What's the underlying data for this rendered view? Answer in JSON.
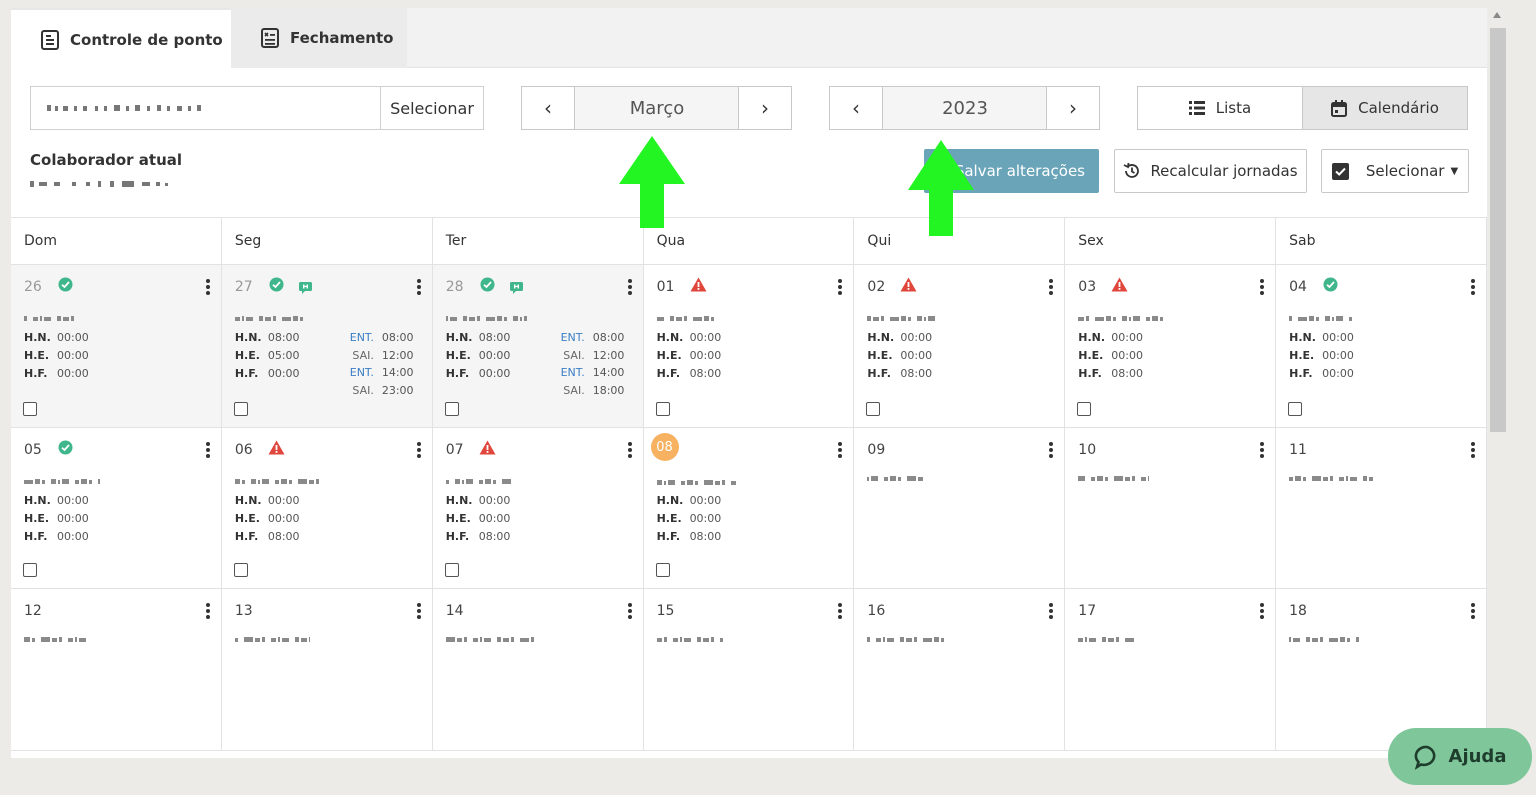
{
  "tabs": [
    {
      "label": "Controle de ponto",
      "icon": "timesheet-icon"
    },
    {
      "label": "Fechamento",
      "icon": "checklist-icon"
    }
  ],
  "collaborator": {
    "select_label": "Selecionar",
    "current_label": "Colaborador atual"
  },
  "month_nav": {
    "value": "Março"
  },
  "year_nav": {
    "value": "2023"
  },
  "views": {
    "list": "Lista",
    "calendar": "Calendário"
  },
  "actions": {
    "save": "Salvar alterações",
    "recalc": "Recalcular jornadas",
    "select": "Selecionar"
  },
  "weekdays": [
    "Dom",
    "Seg",
    "Ter",
    "Qua",
    "Qui",
    "Sex",
    "Sab"
  ],
  "hour_labels": {
    "hn": "H.N.",
    "he": "H.E.",
    "hf": "H.F.",
    "ent": "ENT.",
    "sai": "SAI."
  },
  "weeks": [
    [
      {
        "day": "26",
        "status": "ok",
        "past": true,
        "hn": "00:00",
        "he": "00:00",
        "hf": "00:00"
      },
      {
        "day": "27",
        "status": "ok",
        "flag": true,
        "past": true,
        "hn": "08:00",
        "he": "05:00",
        "hf": "00:00",
        "punches": [
          "08:00",
          "12:00",
          "14:00",
          "23:00"
        ]
      },
      {
        "day": "28",
        "status": "ok",
        "flag": true,
        "past": true,
        "hn": "08:00",
        "he": "00:00",
        "hf": "00:00",
        "punches": [
          "08:00",
          "12:00",
          "14:00",
          "18:00"
        ]
      },
      {
        "day": "01",
        "status": "warn",
        "hn": "00:00",
        "he": "00:00",
        "hf": "08:00"
      },
      {
        "day": "02",
        "status": "warn",
        "hn": "00:00",
        "he": "00:00",
        "hf": "08:00"
      },
      {
        "day": "03",
        "status": "warn",
        "hn": "00:00",
        "he": "00:00",
        "hf": "08:00"
      },
      {
        "day": "04",
        "status": "ok",
        "hn": "00:00",
        "he": "00:00",
        "hf": "00:00"
      }
    ],
    [
      {
        "day": "05",
        "status": "ok",
        "hn": "00:00",
        "he": "00:00",
        "hf": "00:00"
      },
      {
        "day": "06",
        "status": "warn",
        "hn": "00:00",
        "he": "00:00",
        "hf": "08:00"
      },
      {
        "day": "07",
        "status": "warn",
        "hn": "00:00",
        "he": "00:00",
        "hf": "08:00"
      },
      {
        "day": "08",
        "today": true,
        "hn": "00:00",
        "he": "00:00",
        "hf": "08:00"
      },
      {
        "day": "09"
      },
      {
        "day": "10"
      },
      {
        "day": "11"
      }
    ],
    [
      {
        "day": "12"
      },
      {
        "day": "13"
      },
      {
        "day": "14"
      },
      {
        "day": "15"
      },
      {
        "day": "16"
      },
      {
        "day": "17"
      },
      {
        "day": "18"
      }
    ]
  ],
  "help": {
    "label": "Ajuda"
  },
  "colors": {
    "accent": "#6aa4b9",
    "ok": "#3fb68b",
    "warn": "#e0463c",
    "today": "#f6b261",
    "help": "#7fc79a",
    "arrow": "#22f522"
  }
}
